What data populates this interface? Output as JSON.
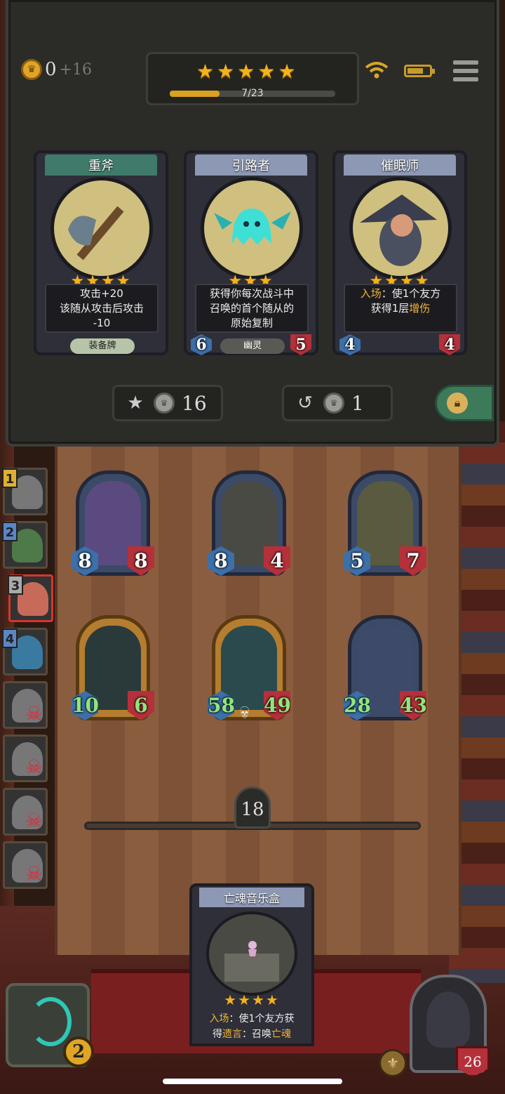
{
  "hud": {
    "gold": "0",
    "gold_income": "+16",
    "tier_stars": 5,
    "xp_text": "7/23",
    "xp_fraction": 0.3
  },
  "shop": {
    "cards": [
      {
        "name": "重斧",
        "stars": "★★★★",
        "desc_lines": [
          "攻击+20",
          "该随从攻击后攻击",
          "-10"
        ],
        "tag": "装备牌"
      },
      {
        "name": "引路者",
        "stars": "★★★",
        "desc_lines": [
          "获得你每次战斗中",
          "召唤的首个随从的",
          "原始复制"
        ],
        "tag": "幽灵",
        "attack": "6",
        "health": "5"
      },
      {
        "name": "催眠师",
        "stars": "★★★★",
        "desc_prefix": "入场",
        "desc_line1": "：使1个友方",
        "desc_line2a": "获得1层",
        "desc_line2b": "增伤",
        "attack": "4",
        "health": "4"
      }
    ],
    "upgrade_cost": "16",
    "refresh_cost": "1"
  },
  "queue": [
    {
      "num": "1",
      "state": "alive"
    },
    {
      "num": "2",
      "state": "alive"
    },
    {
      "num": "3",
      "state": "active"
    },
    {
      "num": "4",
      "state": "alive"
    },
    {
      "num": "",
      "state": "dead"
    },
    {
      "num": "",
      "state": "dead"
    },
    {
      "num": "",
      "state": "dead"
    },
    {
      "num": "",
      "state": "dead"
    }
  ],
  "board": [
    {
      "attack": "8",
      "health": "8"
    },
    {
      "attack": "8",
      "health": "4"
    },
    {
      "attack": "5",
      "health": "7"
    },
    {
      "attack": "10",
      "health": "6"
    },
    {
      "attack": "58",
      "health": "49"
    },
    {
      "attack": "28",
      "health": "43"
    }
  ],
  "turn": "18",
  "hand_card": {
    "name": "亡魂音乐盒",
    "stars": "★★★★",
    "line1_prefix": "入场",
    "line1_rest": "：使1个友方获",
    "line2_a": "得",
    "line2_b": "遗言",
    "line2_c": "：召唤",
    "line2_d": "亡魂"
  },
  "hero": {
    "health": "26",
    "level": "2"
  }
}
